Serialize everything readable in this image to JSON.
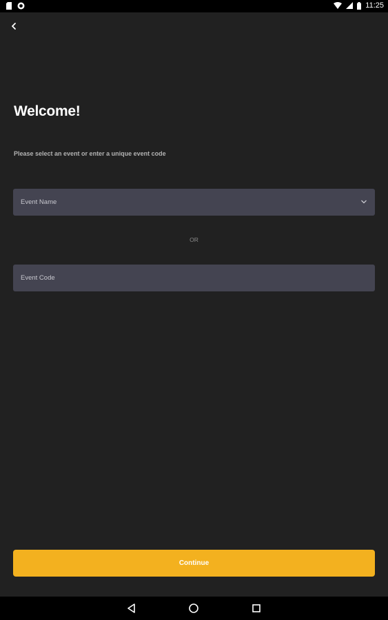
{
  "status_bar": {
    "time": "11:25",
    "icons": [
      "sd-card-icon",
      "app-notification-icon",
      "wifi-icon",
      "signal-icon",
      "battery-icon"
    ]
  },
  "header": {
    "back_icon": "back-arrow-icon"
  },
  "main": {
    "title": "Welcome!",
    "subtitle": "Please select an event or enter a unique event code",
    "event_name_placeholder": "Event Name",
    "or_text": "OR",
    "event_code_placeholder": "Event Code"
  },
  "footer": {
    "continue_label": "Continue"
  },
  "nav_bar": {
    "icons": [
      "nav-back-icon",
      "nav-home-icon",
      "nav-recents-icon"
    ]
  },
  "colors": {
    "background": "#212121",
    "field": "#444451",
    "accent": "#f3b11f",
    "system_bar": "#000000"
  }
}
